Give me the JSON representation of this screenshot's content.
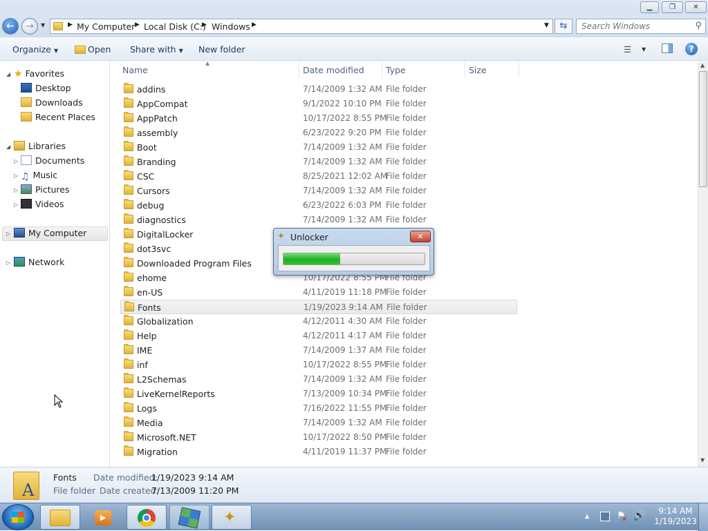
{
  "window": {
    "minimize": "▁",
    "maximize": "❐",
    "close": "✕"
  },
  "address": {
    "crumbs": [
      "My Computer",
      "Local Disk (C:)",
      "Windows"
    ]
  },
  "search": {
    "placeholder": "Search Windows"
  },
  "toolbar": {
    "organize": "Organize",
    "open": "Open",
    "share_with": "Share with",
    "new_folder": "New folder"
  },
  "nav": {
    "favorites": "Favorites",
    "desktop": "Desktop",
    "downloads": "Downloads",
    "recent_places": "Recent Places",
    "libraries": "Libraries",
    "documents": "Documents",
    "music": "Music",
    "pictures": "Pictures",
    "videos": "Videos",
    "my_computer": "My Computer",
    "network": "Network"
  },
  "columns": {
    "name": "Name",
    "date_modified": "Date modified",
    "type": "Type",
    "size": "Size"
  },
  "files": [
    {
      "name": "addins",
      "date": "7/14/2009 1:32 AM",
      "type": "File folder"
    },
    {
      "name": "AppCompat",
      "date": "9/1/2022 10:10 PM",
      "type": "File folder"
    },
    {
      "name": "AppPatch",
      "date": "10/17/2022 8:55 PM",
      "type": "File folder"
    },
    {
      "name": "assembly",
      "date": "6/23/2022 9:20 PM",
      "type": "File folder"
    },
    {
      "name": "Boot",
      "date": "7/14/2009 1:32 AM",
      "type": "File folder"
    },
    {
      "name": "Branding",
      "date": "7/14/2009 1:32 AM",
      "type": "File folder"
    },
    {
      "name": "CSC",
      "date": "8/25/2021 12:02 AM",
      "type": "File folder"
    },
    {
      "name": "Cursors",
      "date": "7/14/2009 1:32 AM",
      "type": "File folder"
    },
    {
      "name": "debug",
      "date": "6/23/2022 6:03 PM",
      "type": "File folder"
    },
    {
      "name": "diagnostics",
      "date": "7/14/2009 1:32 AM",
      "type": "File folder"
    },
    {
      "name": "DigitalLocker",
      "date": "",
      "type": ""
    },
    {
      "name": "dot3svc",
      "date": "",
      "type": ""
    },
    {
      "name": "Downloaded Program Files",
      "date": "",
      "type": ""
    },
    {
      "name": "ehome",
      "date": "10/17/2022 8:55 PM",
      "type": "File folder"
    },
    {
      "name": "en-US",
      "date": "4/11/2019 11:18 PM",
      "type": "File folder"
    },
    {
      "name": "Fonts",
      "date": "1/19/2023 9:14 AM",
      "type": "File folder",
      "selected": true
    },
    {
      "name": "Globalization",
      "date": "4/12/2011 4:30 AM",
      "type": "File folder"
    },
    {
      "name": "Help",
      "date": "4/12/2011 4:17 AM",
      "type": "File folder"
    },
    {
      "name": "IME",
      "date": "7/14/2009 1:37 AM",
      "type": "File folder"
    },
    {
      "name": "inf",
      "date": "10/17/2022 8:55 PM",
      "type": "File folder"
    },
    {
      "name": "L2Schemas",
      "date": "7/14/2009 1:32 AM",
      "type": "File folder"
    },
    {
      "name": "LiveKernelReports",
      "date": "7/13/2009 10:34 PM",
      "type": "File folder"
    },
    {
      "name": "Logs",
      "date": "7/16/2022 11:55 PM",
      "type": "File folder"
    },
    {
      "name": "Media",
      "date": "7/14/2009 1:32 AM",
      "type": "File folder"
    },
    {
      "name": "Microsoft.NET",
      "date": "10/17/2022 8:50 PM",
      "type": "File folder"
    },
    {
      "name": "Migration",
      "date": "4/11/2019 11:37 PM",
      "type": "File folder"
    }
  ],
  "details": {
    "name": "Fonts",
    "type": "File folder",
    "date_modified_label": "Date modified:",
    "date_modified": "1/19/2023 9:14 AM",
    "date_created_label": "Date created:",
    "date_created": "7/13/2009 11:20 PM"
  },
  "unlocker": {
    "title": "Unlocker",
    "close": "✕",
    "progress": 0.4
  },
  "clock": {
    "time": "9:14 AM",
    "date": "1/19/2023"
  }
}
